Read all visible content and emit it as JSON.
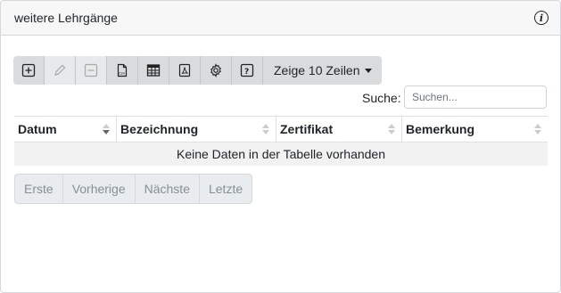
{
  "card": {
    "title": "weitere Lehrgänge",
    "info_icon": "info-icon"
  },
  "toolbar": {
    "buttons": [
      {
        "name": "add-icon",
        "enabled": true
      },
      {
        "name": "edit-icon",
        "enabled": false
      },
      {
        "name": "delete-icon",
        "enabled": false
      },
      {
        "name": "csv-export-icon",
        "enabled": true
      },
      {
        "name": "table-icon",
        "enabled": true
      },
      {
        "name": "pdf-icon",
        "enabled": true
      },
      {
        "name": "gear-icon",
        "enabled": true
      },
      {
        "name": "help-icon",
        "enabled": true
      }
    ],
    "rows_label": "Zeige 10 Zeilen"
  },
  "search": {
    "label": "Suche:",
    "placeholder": "Suchen..."
  },
  "table": {
    "columns": [
      "Datum",
      "Bezeichnung",
      "Zertifikat",
      "Bemerkung"
    ],
    "sorted_column": "Datum",
    "sort_direction": "descending",
    "empty_message": "Keine Daten in der Tabelle vorhanden"
  },
  "pagination": {
    "first": "Erste",
    "previous": "Vorherige",
    "next": "Nächste",
    "last": "Letzte"
  }
}
